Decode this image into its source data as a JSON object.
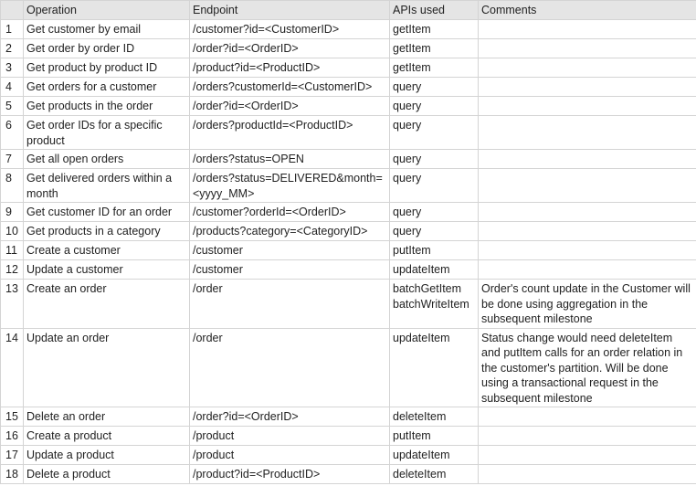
{
  "headers": {
    "num": "",
    "operation": "Operation",
    "endpoint": "Endpoint",
    "apis": "APIs used",
    "comments": "Comments"
  },
  "rows": [
    {
      "n": "1",
      "op": "Get customer by email",
      "ep": "/customer?id=<CustomerID>",
      "api": "getItem",
      "com": ""
    },
    {
      "n": "2",
      "op": "Get order by order ID",
      "ep": "/order?id=<OrderID>",
      "api": "getItem",
      "com": ""
    },
    {
      "n": "3",
      "op": "Get product by product ID",
      "ep": "/product?id=<ProductID>",
      "api": "getItem",
      "com": ""
    },
    {
      "n": "4",
      "op": "Get orders for a customer",
      "ep": "/orders?customerId=<CustomerID>",
      "api": "query",
      "com": ""
    },
    {
      "n": "5",
      "op": "Get products in the order",
      "ep": "/order?id=<OrderID>",
      "api": "query",
      "com": ""
    },
    {
      "n": "6",
      "op": "Get order IDs for a specific product",
      "ep": "/orders?productId=<ProductID>",
      "api": "query",
      "com": ""
    },
    {
      "n": "7",
      "op": "Get all open orders",
      "ep": "/orders?status=OPEN",
      "api": "query",
      "com": ""
    },
    {
      "n": "8",
      "op": "Get delivered orders within a month",
      "ep": "/orders?status=DELIVERED&month=<yyyy_MM>",
      "api": "query",
      "com": ""
    },
    {
      "n": "9",
      "op": "Get customer ID for an order",
      "ep": "/customer?orderId=<OrderID>",
      "api": "query",
      "com": ""
    },
    {
      "n": "10",
      "op": "Get products in a category",
      "ep": "/products?category=<CategoryID>",
      "api": "query",
      "com": ""
    },
    {
      "n": "11",
      "op": "Create a customer",
      "ep": "/customer",
      "api": "putItem",
      "com": ""
    },
    {
      "n": "12",
      "op": "Update a customer",
      "ep": "/customer",
      "api": "updateItem",
      "com": ""
    },
    {
      "n": "13",
      "op": "Create an order",
      "ep": "/order",
      "api": "batchGetItem batchWriteItem",
      "com": "Order's count update in the Customer will be done using aggregation in the subsequent milestone"
    },
    {
      "n": "14",
      "op": "Update an order",
      "ep": "/order",
      "api": "updateItem",
      "com": "Status change would need deleteItem and putItem calls for an order relation in the customer's partition. Will be done using a transactional request in the subsequent milestone"
    },
    {
      "n": "15",
      "op": "Delete an order",
      "ep": "/order?id=<OrderID>",
      "api": "deleteItem",
      "com": ""
    },
    {
      "n": "16",
      "op": "Create a product",
      "ep": "/product",
      "api": "putItem",
      "com": ""
    },
    {
      "n": "17",
      "op": "Update a product",
      "ep": "/product",
      "api": "updateItem",
      "com": ""
    },
    {
      "n": "18",
      "op": "Delete a product",
      "ep": "/product?id=<ProductID>",
      "api": "deleteItem",
      "com": ""
    }
  ]
}
